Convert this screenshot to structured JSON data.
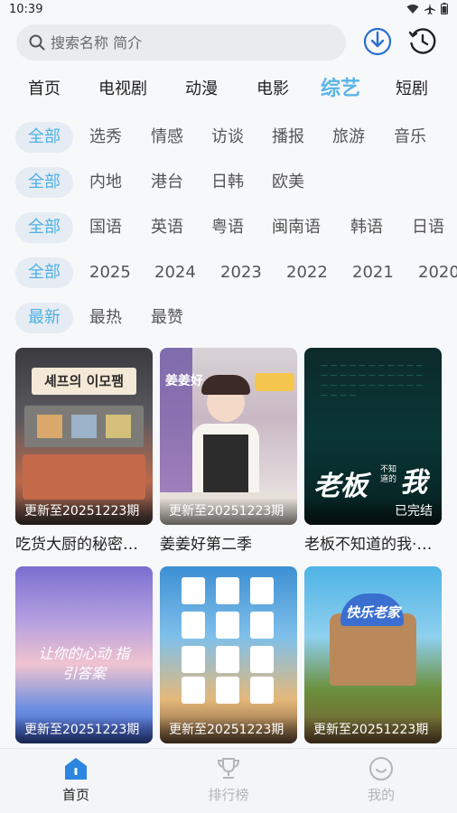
{
  "status": {
    "time": "10:39"
  },
  "search": {
    "placeholder": "搜索名称 简介"
  },
  "main_tabs": [
    "首页",
    "电视剧",
    "动漫",
    "电影",
    "综艺",
    "短剧"
  ],
  "filters": {
    "genre": [
      "全部",
      "选秀",
      "情感",
      "访谈",
      "播报",
      "旅游",
      "音乐"
    ],
    "region": [
      "全部",
      "内地",
      "港台",
      "日韩",
      "欧美"
    ],
    "language": [
      "全部",
      "国语",
      "英语",
      "粤语",
      "闽南语",
      "韩语",
      "日语"
    ],
    "year": [
      "全部",
      "2025",
      "2024",
      "2023",
      "2022",
      "2021",
      "2020"
    ],
    "sort": [
      "最新",
      "最热",
      "最赞"
    ]
  },
  "cards": [
    {
      "badge": "更新至20251223期",
      "title": "吃货大厨的秘密…"
    },
    {
      "badge": "更新至20251223期",
      "title": "姜姜好第二季"
    },
    {
      "badge": "已完结",
      "title": "老板不知道的我·…"
    },
    {
      "badge": "更新至20251223期",
      "title": ""
    },
    {
      "badge": "更新至20251223期",
      "title": ""
    },
    {
      "badge": "更新至20251223期",
      "title": ""
    }
  ],
  "poster_text": {
    "p1": "셰프의 이모팸",
    "p2": "姜姜好",
    "p3_big": "老板",
    "p3_small": "不知道的",
    "p3_end": "我",
    "p4": "让你的心动 指引答案",
    "p6": "快乐老家"
  },
  "bottom_nav": [
    {
      "label": "首页",
      "icon": "home-icon"
    },
    {
      "label": "排行榜",
      "icon": "trophy-icon"
    },
    {
      "label": "我的",
      "icon": "profile-icon"
    }
  ],
  "colors": {
    "accent": "#5ab4e6",
    "chip_bg": "#e6ecf3"
  }
}
